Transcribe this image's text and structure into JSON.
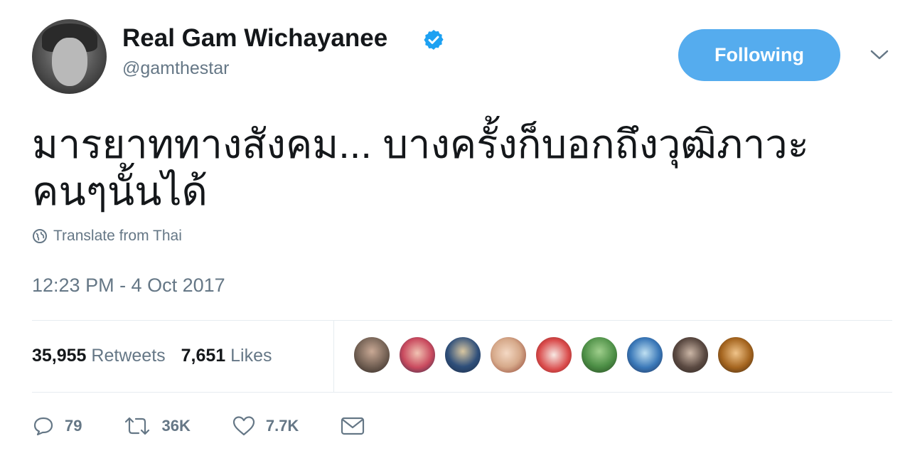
{
  "profile": {
    "name": "Real Gam Wichayanee",
    "handle": "@gamthestar",
    "verified": true
  },
  "follow_button_label": "Following",
  "tweet": {
    "text_line1": "มารยาททางสังคม... บางครั้งก็บอกถึงวุฒิภาวะ",
    "text_line2": "คนๆนั้นได้",
    "translate_label": "Translate from Thai",
    "timestamp": "12:23 PM - 4 Oct 2017"
  },
  "stats": {
    "retweets_count": "35,955",
    "retweets_label": "Retweets",
    "likes_count": "7,651",
    "likes_label": "Likes"
  },
  "likers": [
    {
      "icon": "liker-avatar",
      "color": "#6b5a4e"
    },
    {
      "icon": "liker-avatar",
      "color": "#c94a5e"
    },
    {
      "icon": "liker-avatar",
      "color": "#2f4f7a"
    },
    {
      "icon": "liker-avatar",
      "color": "#d6a98a"
    },
    {
      "icon": "liker-avatar",
      "color": "#d94a4a"
    },
    {
      "icon": "liker-avatar",
      "color": "#4d8f46"
    },
    {
      "icon": "liker-avatar",
      "color": "#3a78b8"
    },
    {
      "icon": "liker-avatar",
      "color": "#5b4a42"
    },
    {
      "icon": "liker-avatar",
      "color": "#a5651f"
    }
  ],
  "actions": {
    "reply_count": "79",
    "retweet_count": "36K",
    "like_count": "7.7K"
  },
  "colors": {
    "accent": "#55acee",
    "verified_badge": "#1da1f2",
    "secondary_text": "#657786"
  }
}
